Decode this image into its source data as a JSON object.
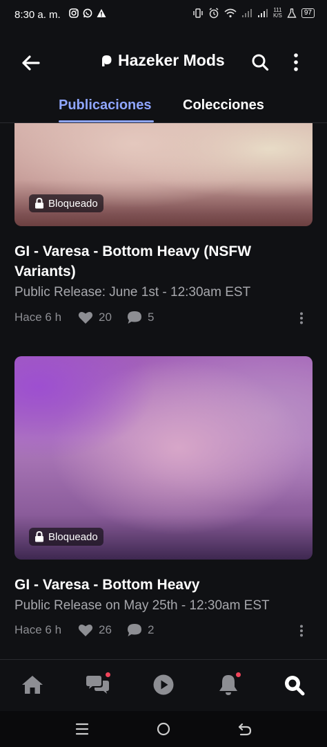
{
  "status_bar": {
    "time": "8:30 a. m.",
    "net_speed_top": "111",
    "net_speed_bottom": "K/S",
    "battery": "97"
  },
  "header": {
    "title": "Hazeker Mods",
    "icons": [
      "arrow-left-icon",
      "patreon-logo-icon",
      "search-icon",
      "more-vertical-icon"
    ]
  },
  "tabs": [
    {
      "label": "Publicaciones",
      "active": true
    },
    {
      "label": "Colecciones",
      "active": false
    }
  ],
  "posts": [
    {
      "badge": "Bloqueado",
      "title": "GI - Varesa - Bottom Heavy (NSFW Variants)",
      "subtitle": "Public Release: June 1st - 12:30am EST",
      "time": "Hace 6 h",
      "likes": "20",
      "comments": "5"
    },
    {
      "badge": "Bloqueado",
      "title": "GI - Varesa - Bottom Heavy",
      "subtitle": "Public Release on May 25th - 12:30am EST",
      "time": "Hace 6 h",
      "likes": "26",
      "comments": "2"
    }
  ],
  "bottom_nav": {
    "items": [
      "home-icon",
      "chats-icon",
      "play-icon",
      "bell-icon",
      "search-icon"
    ],
    "active": "search-icon",
    "badges": [
      "chats-icon",
      "bell-icon"
    ]
  },
  "colors": {
    "accent": "#8fa6ff",
    "background": "#101114",
    "notification_dot": "#f0445a"
  }
}
